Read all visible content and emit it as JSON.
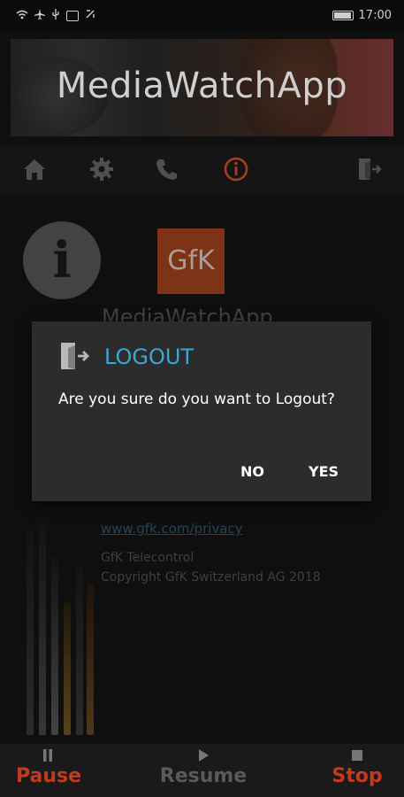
{
  "status": {
    "time": "17:00"
  },
  "header": {
    "title": "MediaWatchApp"
  },
  "toolbar": {
    "items": [
      "home-icon",
      "settings-icon",
      "phone-icon",
      "info-icon",
      "logout-icon"
    ],
    "active_color": "#d9572b"
  },
  "about": {
    "logo_text": "GfK",
    "app_name": "MediaWatchApp",
    "privacy_link": "www.gfk.com/privacy",
    "company": "GfK Telecontrol",
    "copyright": "Copyright GfK Switzerland AG 2018"
  },
  "dialog": {
    "title": "LOGOUT",
    "message": "Are you sure do you want to Logout?",
    "no_label": "NO",
    "yes_label": "YES",
    "title_color": "#3aa6d6"
  },
  "bottom_bar": {
    "pause_label": "Pause",
    "resume_label": "Resume",
    "stop_label": "Stop",
    "accent_color": "#c43a1e"
  }
}
